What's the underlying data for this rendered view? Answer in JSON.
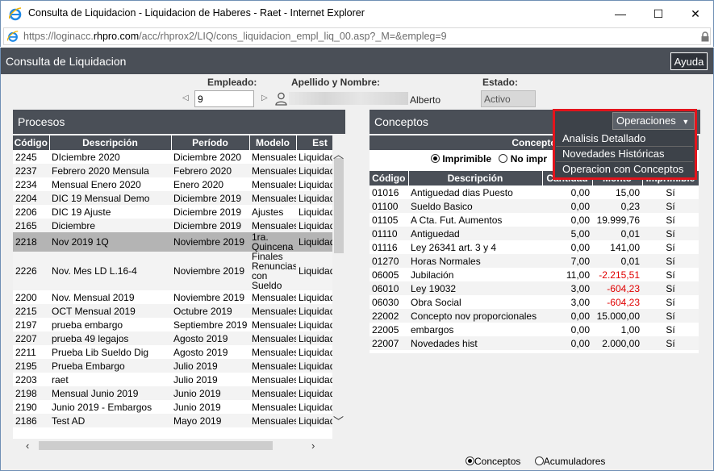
{
  "window": {
    "title": "Consulta de Liquidacion - Liquidacion de Haberes - Raet - Internet Explorer",
    "url_prefix": "https://loginacc.",
    "url_domain": "rhpro.com",
    "url_path": "/acc/rhprox2/LIQ/cons_liquidacion_empl_liq_00.asp?_M=&empleg=9",
    "minimize": "—",
    "maximize": "☐",
    "close": "✕"
  },
  "header": {
    "title": "Consulta de Liquidacion",
    "help_label": "Ayuda"
  },
  "filters": {
    "empleado_label": "Empleado:",
    "empleado_value": "9",
    "nombre_label": "Apellido y Nombre:",
    "nombre_value": "Alberto",
    "estado_label": "Estado:",
    "estado_value": "Activo"
  },
  "procesos": {
    "title": "Procesos",
    "columns": [
      "Código",
      "Descripción",
      "Período",
      "Modelo",
      "Est"
    ],
    "rows": [
      [
        "2245",
        "DIciembre 2020",
        "Diciembre 2020",
        "Mensuales",
        "Liquidad"
      ],
      [
        "2237",
        "Febrero 2020 Mensula",
        "Febrero 2020",
        "Mensuales",
        "Liquidad"
      ],
      [
        "2234",
        "Mensual Enero 2020",
        "Enero 2020",
        "Mensuales",
        "Liquidad"
      ],
      [
        "2204",
        "DIC 19 Mensual Demo",
        "Diciembre 2019",
        "Mensuales",
        "Liquidad"
      ],
      [
        "2206",
        "DIC 19 Ajuste",
        "Diciembre 2019",
        "Ajustes",
        "Liquidad"
      ],
      [
        "2165",
        "Diciembre",
        "Diciembre 2019",
        "Mensuales",
        "Liquidad"
      ],
      [
        "2218",
        "Nov 2019 1Q",
        "Noviembre 2019",
        "1ra. Quincena",
        "Liquidad"
      ],
      [
        "2226",
        "Nov. Mes LD L.16-4",
        "Noviembre 2019",
        "Finales Renuncias con Sueldo",
        "Liquidad"
      ],
      [
        "2200",
        "Nov. Mensual 2019",
        "Noviembre 2019",
        "Mensuales",
        "Liquidad"
      ],
      [
        "2215",
        "OCT Mensual 2019",
        "Octubre 2019",
        "Mensuales",
        "Liquidad"
      ],
      [
        "2197",
        "prueba embargo",
        "Septiembre 2019",
        "Mensuales",
        "Liquidad"
      ],
      [
        "2207",
        "prueba 49 legajos",
        "Agosto 2019",
        "Mensuales",
        "Liquidad"
      ],
      [
        "2211",
        "Prueba Lib Sueldo Dig",
        "Agosto 2019",
        "Mensuales",
        "Liquidad"
      ],
      [
        "2195",
        "Prueba Embargo",
        "Julio 2019",
        "Mensuales",
        "Liquidad"
      ],
      [
        "2203",
        "raet",
        "Julio 2019",
        "Mensuales",
        "Liquidad"
      ],
      [
        "2198",
        "Mensual Junio 2019",
        "Junio 2019",
        "Mensuales",
        "Liquidad"
      ],
      [
        "2190",
        "Junio 2019 - Embargos",
        "Junio 2019",
        "Mensuales",
        "Liquidad"
      ],
      [
        "2186",
        "Test AD",
        "Mayo 2019",
        "Mensuales",
        "Liquidad"
      ]
    ]
  },
  "conceptos": {
    "title": "Conceptos",
    "group_header": "Concepto",
    "radio_imprimible": "Imprimible",
    "radio_noimprimible": "No impr",
    "columns": [
      "Código",
      "Descripción",
      "Cantidad",
      "Monto",
      "Imprimible"
    ],
    "rows": [
      [
        "01016",
        "Antiguedad dias Puesto",
        "0,00",
        "15,00",
        "Sí"
      ],
      [
        "01100",
        "Sueldo Basico",
        "0,00",
        "0,23",
        "Sí"
      ],
      [
        "01105",
        "A Cta. Fut. Aumentos",
        "0,00",
        "19.999,76",
        "Sí"
      ],
      [
        "01110",
        "Antiguedad",
        "5,00",
        "0,01",
        "Sí"
      ],
      [
        "01116",
        "Ley 26341 art. 3 y 4",
        "0,00",
        "141,00",
        "Sí"
      ],
      [
        "01270",
        "Horas Normales",
        "7,00",
        "0,01",
        "Sí"
      ],
      [
        "06005",
        "Jubilación",
        "11,00",
        "-2.215,51",
        "Sí"
      ],
      [
        "06010",
        "Ley 19032",
        "3,00",
        "-604,23",
        "Sí"
      ],
      [
        "06030",
        "Obra Social",
        "3,00",
        "-604,23",
        "Sí"
      ],
      [
        "22002",
        "Concepto nov proporcionales",
        "0,00",
        "15.000,00",
        "Sí"
      ],
      [
        "22005",
        "embargos",
        "0,00",
        "1,00",
        "Sí"
      ],
      [
        "22007",
        "Novedades hist",
        "0,00",
        "2.000,00",
        "Sí"
      ]
    ]
  },
  "operaciones": {
    "label": "Operaciones",
    "items": [
      "Analisis Detallado",
      "Novedades Históricas",
      "Operacion con Conceptos"
    ]
  },
  "bottom": {
    "radio_conceptos": "Conceptos",
    "radio_acumuladores": "Acumuladores"
  },
  "colors": {
    "header_bg": "#4a4f57",
    "highlight_border": "#e3141c",
    "negative": "#e00000",
    "selected_row": "#b4b4b4"
  }
}
